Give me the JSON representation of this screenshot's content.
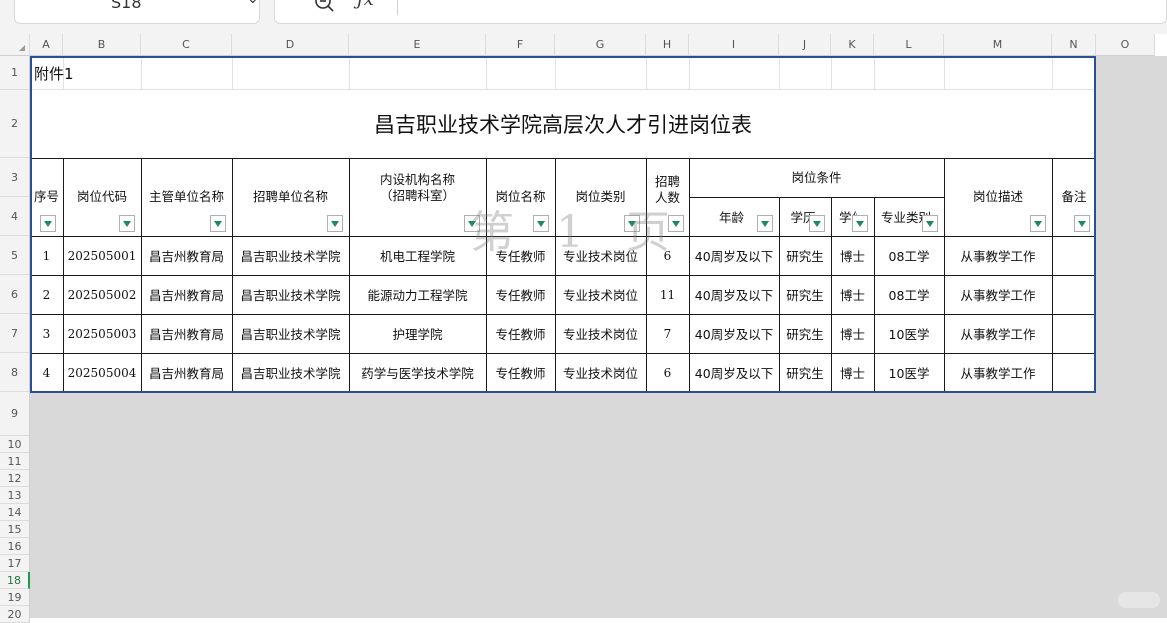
{
  "namebox": {
    "cell_ref": "S18"
  },
  "formula_bar": {
    "fx_label": "ƒx",
    "value": ""
  },
  "columns": [
    "A",
    "B",
    "C",
    "D",
    "E",
    "F",
    "G",
    "H",
    "I",
    "J",
    "K",
    "L",
    "M",
    "N",
    "O"
  ],
  "rows": [
    "1",
    "2",
    "3",
    "4",
    "5",
    "6",
    "7",
    "8",
    "9",
    "10",
    "11",
    "12",
    "13",
    "14",
    "15",
    "16",
    "17",
    "18",
    "19",
    "20"
  ],
  "sheet": {
    "attachment_label": "附件1",
    "title": "昌吉职业技术学院高层次人才引进岗位表",
    "watermark": "第 1 页",
    "headers": {
      "seq": "序号",
      "post_code": "岗位代码",
      "dept": "主管单位名称",
      "unit": "招聘单位名称",
      "inner_org_line1": "内设机构名称",
      "inner_org_line2": "（招聘科室）",
      "post_name": "岗位名称",
      "post_type": "岗位类别",
      "count_line1": "招聘",
      "count_line2": "人数",
      "conditions": "岗位条件",
      "age": "年龄",
      "edu": "学历",
      "degree": "学位",
      "major": "专业类别",
      "desc": "岗位描述",
      "remark": "备注"
    },
    "data_rows": [
      {
        "seq": "1",
        "code": "202505001",
        "dept": "昌吉州教育局",
        "unit": "昌吉职业技术学院",
        "org": "机电工程学院",
        "post": "专任教师",
        "type": "专业技术岗位",
        "count": "6",
        "age": "40周岁及以下",
        "edu": "研究生",
        "degree": "博士",
        "major": "08工学",
        "desc": "从事教学工作",
        "remark": ""
      },
      {
        "seq": "2",
        "code": "202505002",
        "dept": "昌吉州教育局",
        "unit": "昌吉职业技术学院",
        "org": "能源动力工程学院",
        "post": "专任教师",
        "type": "专业技术岗位",
        "count": "11",
        "age": "40周岁及以下",
        "edu": "研究生",
        "degree": "博士",
        "major": "08工学",
        "desc": "从事教学工作",
        "remark": ""
      },
      {
        "seq": "3",
        "code": "202505003",
        "dept": "昌吉州教育局",
        "unit": "昌吉职业技术学院",
        "org": "护理学院",
        "post": "专任教师",
        "type": "专业技术岗位",
        "count": "7",
        "age": "40周岁及以下",
        "edu": "研究生",
        "degree": "博士",
        "major": "10医学",
        "desc": "从事教学工作",
        "remark": ""
      },
      {
        "seq": "4",
        "code": "202505004",
        "dept": "昌吉州教育局",
        "unit": "昌吉职业技术学院",
        "org": "药学与医学技术学院",
        "post": "专任教师",
        "type": "专业技术岗位",
        "count": "6",
        "age": "40周岁及以下",
        "edu": "研究生",
        "degree": "博士",
        "major": "10医学",
        "desc": "从事教学工作",
        "remark": ""
      }
    ]
  },
  "icons": {
    "zoom": "zoom-out-icon",
    "chevron": "chevron-down-icon",
    "filter": "filter-dropdown-icon"
  },
  "colors": {
    "sheet_border": "#2a4f96",
    "filter_arrow": "#1e8a5c",
    "selected_row": "#1f9a4c",
    "gray_area": "#d9d9d9"
  }
}
